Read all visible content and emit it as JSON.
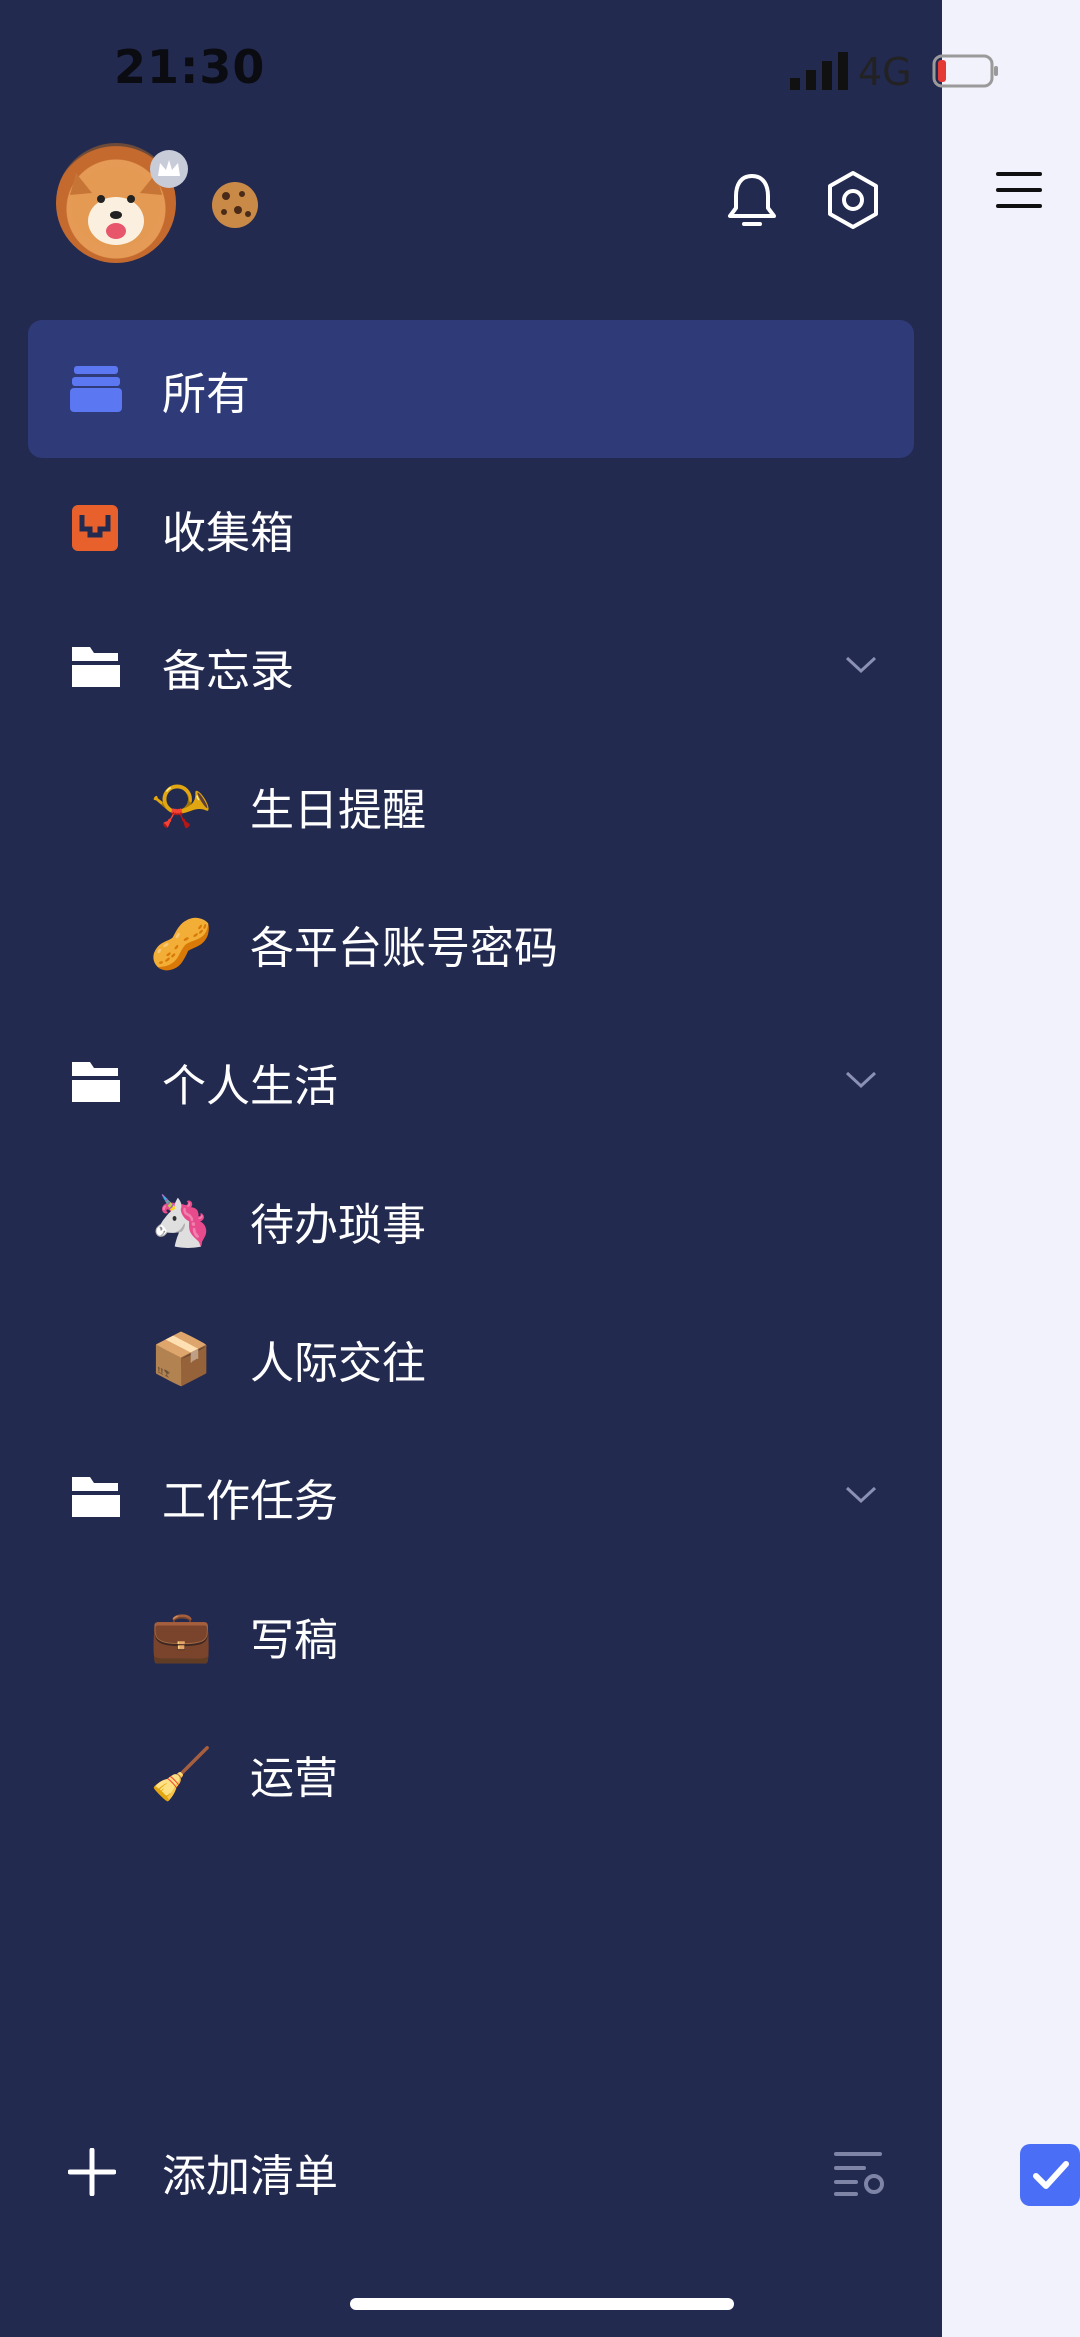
{
  "status_bar": {
    "time": "21:30",
    "network": "4G"
  },
  "header": {
    "icons": [
      "avatar",
      "crown-icon",
      "cookie-icon",
      "bell-icon",
      "settings-icon",
      "hamburger-icon"
    ]
  },
  "colors": {
    "drawer_bg": "#232a50",
    "active_bg": "#2f3a79",
    "accent": "#4b6ef6",
    "inbox": "#e8612c"
  },
  "nav": {
    "all": "所有",
    "inbox": "收集箱",
    "folders": [
      {
        "label": "备忘录",
        "items": [
          {
            "emoji": "📯",
            "label": "生日提醒"
          },
          {
            "emoji": "🥜",
            "label": "各平台账号密码"
          }
        ]
      },
      {
        "label": "个人生活",
        "items": [
          {
            "emoji": "🦄",
            "label": "待办琐事"
          },
          {
            "emoji": "📦",
            "label": "人际交往"
          }
        ]
      },
      {
        "label": "工作任务",
        "items": [
          {
            "emoji": "💼",
            "label": "写稿"
          },
          {
            "emoji": "🧹",
            "label": "运营"
          }
        ]
      }
    ]
  },
  "footer": {
    "add_label": "添加清单"
  }
}
